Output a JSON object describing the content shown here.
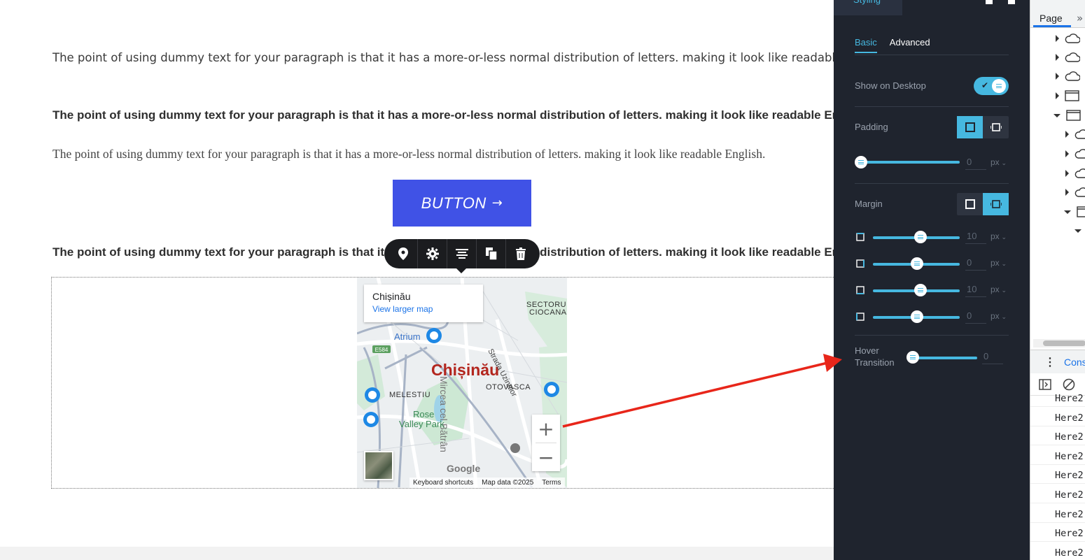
{
  "canvas": {
    "paragraph_1": "The point of using dummy text for your paragraph is that it has a more-or-less normal distribution of letters. making it look like readable English.",
    "paragraph_2": "The point of using dummy text for your paragraph is that it has a more-or-less normal distribution of letters. making it look like readable English.",
    "paragraph_3": "The point of using dummy text for your paragraph is that it has a more-or-less normal distribution of letters. making it look like readable English.",
    "paragraph_4": "The point of using dummy text for your paragraph is that it has a more-or-less normal distribution of letters. making it look like readable English.",
    "button_label": "BUTTON",
    "button_arrow": "→",
    "button_color": "#4052e6",
    "element_toolbar": [
      "map-pin-icon",
      "gear-icon",
      "align-icon",
      "duplicate-icon",
      "trash-icon"
    ]
  },
  "map": {
    "place_title": "Chișinău",
    "view_larger": "View larger map",
    "city_label": "Chișinău",
    "district_1": "SECTORU",
    "district_1b": "CIOCANA",
    "district_2": "OTOVASCA",
    "district_3": "MELESTIU",
    "poi_1": "Atrium",
    "park": "Rose",
    "park_2": "Valley Park",
    "road_1": "Strada Uzinelor",
    "road_badge": "E584",
    "footer": [
      "Keyboard shortcuts",
      "Map data ©2025",
      "Terms"
    ],
    "brand": "Google",
    "zoom_in": "+",
    "zoom_out": "−"
  },
  "panel": {
    "top_tab": "Styling",
    "subtabs": [
      "Basic",
      "Advanced"
    ],
    "show_desktop_label": "Show on Desktop",
    "show_desktop_enabled": true,
    "padding_label": "Padding",
    "padding_value": "0",
    "margin_label": "Margin",
    "margin_values": [
      "10",
      "0",
      "10",
      "0"
    ],
    "unit": "px",
    "hover_label_1": "Hover",
    "hover_label_2": "Transition",
    "hover_value": "0",
    "accent": "#46b8e0"
  },
  "devtools": {
    "tab": "Page",
    "console_tab": "Cons",
    "logs": [
      "Here2",
      "Here2",
      "Here2",
      "Here2",
      "Here2",
      "Here2",
      "Here2",
      "Here2",
      "Here2"
    ]
  }
}
